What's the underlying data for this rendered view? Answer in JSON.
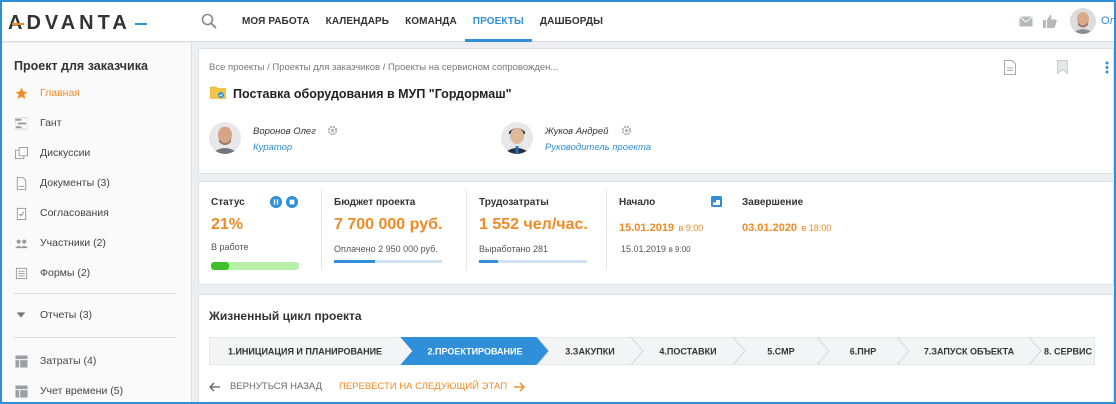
{
  "brand": {
    "logo_text": "ADVANTA",
    "accent": "#2f8fd8",
    "orange": "#f08a24"
  },
  "topnav": {
    "items": [
      {
        "label": "МОЯ РАБОТА",
        "active": false
      },
      {
        "label": "КАЛЕНДАРЬ",
        "active": false
      },
      {
        "label": "КОМАНДА",
        "active": false
      },
      {
        "label": "ПРОЕКТЫ",
        "active": true
      },
      {
        "label": "ДАШБОРДЫ",
        "active": false
      }
    ],
    "user_short": "Ол"
  },
  "sidebar": {
    "title": "Проект для заказчика",
    "items": [
      {
        "label": "Главная",
        "icon": "star-icon",
        "active": true
      },
      {
        "label": "Гант",
        "icon": "gantt-icon"
      },
      {
        "label": "Дискуссии",
        "icon": "discussions-icon"
      },
      {
        "label": "Документы (3)",
        "icon": "document-icon"
      },
      {
        "label": "Согласования",
        "icon": "approval-icon"
      },
      {
        "label": "Участники (2)",
        "icon": "participants-icon"
      },
      {
        "label": "Формы (2)",
        "icon": "forms-icon"
      },
      {
        "label": "Отчеты (3)",
        "icon": "caret-down-icon"
      },
      {
        "label": "Затраты (4)",
        "icon": "table-icon"
      },
      {
        "label": "Учет времени (5)",
        "icon": "table-icon"
      }
    ]
  },
  "header": {
    "breadcrumb": "Все проекты / Проекты для заказчиков / Проекты на сервисном сопровожден...",
    "title": "Поставка оборудования в МУП \"Гордормаш\"",
    "people": [
      {
        "name": "Воронов Олег",
        "role": "Куратор"
      },
      {
        "name": "Жуков Андрей",
        "role": "Руководитель проекта"
      }
    ]
  },
  "kpi": {
    "status": {
      "label": "Статус",
      "value": "21%",
      "sub": "В работе",
      "progress": 0.21
    },
    "budget": {
      "label": "Бюджет проекта",
      "value": "7 700 000 руб.",
      "sub": "Оплачено  2 950 000 руб.",
      "progress": 0.38
    },
    "labor": {
      "label": "Трудозатраты",
      "value": "1 552 чел/час.",
      "sub": "Выработано  281",
      "progress": 0.18
    },
    "start": {
      "label": "Начало",
      "date": "15.01.2019",
      "time": "в 9:00",
      "sub_date": "15.01.2019",
      "sub_time": "в 9:00"
    },
    "finish": {
      "label": "Завершение",
      "date": "03.01.2020",
      "time": "в 18:00"
    }
  },
  "lifecycle": {
    "title": "Жизненный цикл проекта",
    "stages": [
      {
        "label": "1.ИНИЦИАЦИЯ И ПЛАНИРОВАНИЕ",
        "active": false
      },
      {
        "label": "2.ПРОЕКТИРОВАНИЕ",
        "active": true
      },
      {
        "label": "3.ЗАКУПКИ",
        "active": false
      },
      {
        "label": "4.ПОСТАВКИ",
        "active": false
      },
      {
        "label": "5.СМР",
        "active": false
      },
      {
        "label": "6.ПНР",
        "active": false
      },
      {
        "label": "7.ЗАПУСК ОБЪЕКТА",
        "active": false
      },
      {
        "label": "8. СЕРВИС",
        "active": false
      }
    ],
    "back_label": "ВЕРНУТЬСЯ НАЗАД",
    "next_label": "ПЕРЕВЕСТИ НА СЛЕДУЮЩИЙ ЭТАП"
  }
}
